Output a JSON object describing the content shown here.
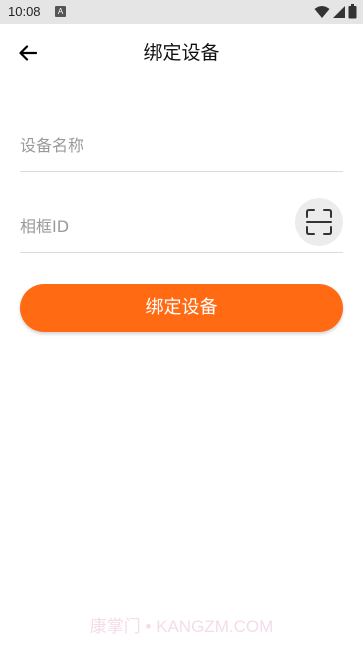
{
  "status_bar": {
    "time": "10:08",
    "notification_badge": "A",
    "icons": [
      "wifi-icon",
      "signal-icon",
      "battery-icon"
    ]
  },
  "header": {
    "back_icon": "arrow-left-icon",
    "title": "绑定设备"
  },
  "form": {
    "device_name": {
      "placeholder": "设备名称",
      "value": ""
    },
    "frame_id": {
      "placeholder": "相框ID",
      "value": ""
    },
    "scan_icon": "scan-icon"
  },
  "bind_button": {
    "label": "绑定设备"
  },
  "watermark": "康掌门 • KANGZM.COM",
  "colors": {
    "accent": "#ff6a13",
    "status_bar": "#e5e5e5",
    "divider": "#dcdcdc",
    "placeholder": "#9a9a9a"
  }
}
